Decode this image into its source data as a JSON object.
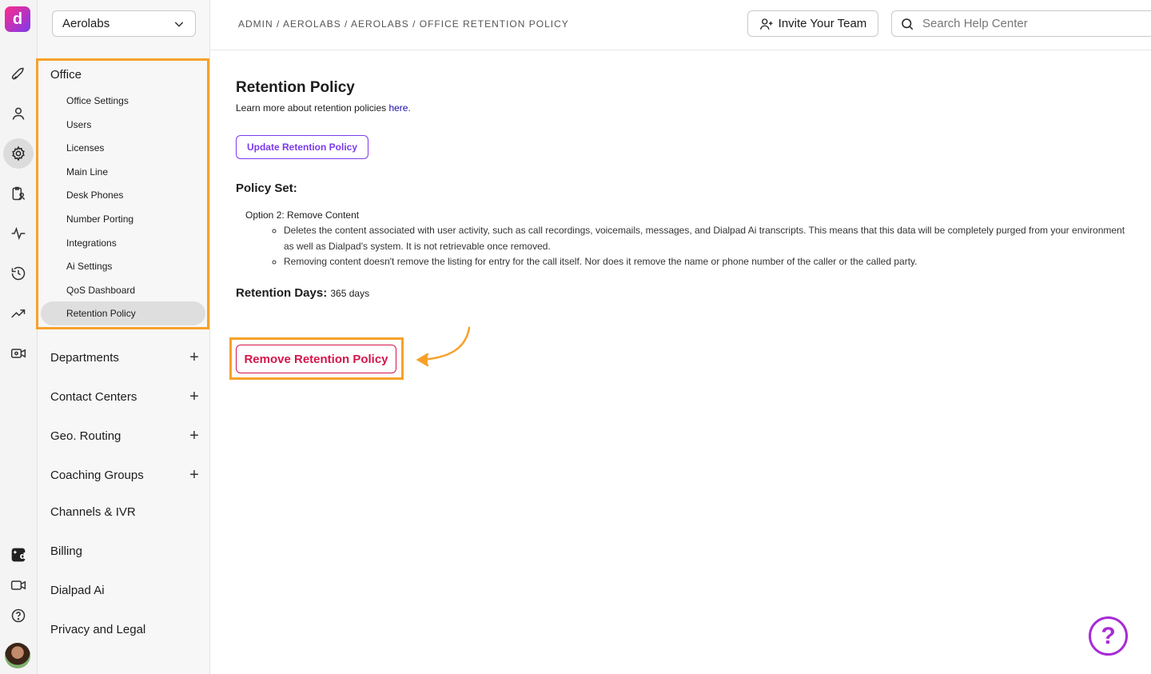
{
  "rail": {
    "logo": "d",
    "icons": [
      "rocket-icon",
      "person-icon",
      "gear-icon",
      "clipboard-user-icon",
      "activity-icon",
      "history-icon",
      "trending-icon",
      "video-settings-icon",
      "dialpad-ai-icon",
      "video-icon",
      "help-icon"
    ]
  },
  "sidebar": {
    "org": "Aerolabs",
    "office_heading": "Office",
    "office_items": [
      "Office Settings",
      "Users",
      "Licenses",
      "Main Line",
      "Desk Phones",
      "Number Porting",
      "Integrations",
      "Ai Settings",
      "QoS Dashboard",
      "Retention Policy"
    ],
    "active_item": "Retention Policy",
    "sections": [
      {
        "label": "Departments",
        "expandable": true
      },
      {
        "label": "Contact Centers",
        "expandable": true
      },
      {
        "label": "Geo. Routing",
        "expandable": true
      },
      {
        "label": "Coaching Groups",
        "expandable": true
      },
      {
        "label": "Channels & IVR",
        "expandable": false
      },
      {
        "label": "Billing",
        "expandable": false
      },
      {
        "label": "Dialpad Ai",
        "expandable": false
      },
      {
        "label": "Privacy and Legal",
        "expandable": false
      }
    ],
    "plus": "+"
  },
  "topbar": {
    "breadcrumb": "ADMIN / AEROLABS / AEROLABS / OFFICE RETENTION POLICY",
    "invite_label": "Invite Your Team",
    "search_placeholder": "Search Help Center"
  },
  "main": {
    "title": "Retention Policy",
    "learn_text": "Learn more about retention policies ",
    "learn_link": "here",
    "learn_end": ".",
    "update_button": "Update Retention Policy",
    "policy_set_label": "Policy Set:",
    "option_label": "Option 2: Remove Content",
    "bullets": [
      "Deletes the content associated with user activity, such as call recordings, voicemails, messages, and Dialpad Ai transcripts. This means that this data will be completely purged from your environment as well as Dialpad's system. It is not retrievable once removed.",
      "Removing content doesn't remove the listing for entry for the call itself. Nor does it remove the name or phone number of the caller or the called party."
    ],
    "retention_days_label": "Retention Days:",
    "retention_days_value": "365 days",
    "remove_button": "Remove Retention Policy"
  },
  "help_fab": "?",
  "colors": {
    "highlight": "#f7a12b",
    "accent_purple": "#7c3aed",
    "danger": "#d6154a"
  }
}
